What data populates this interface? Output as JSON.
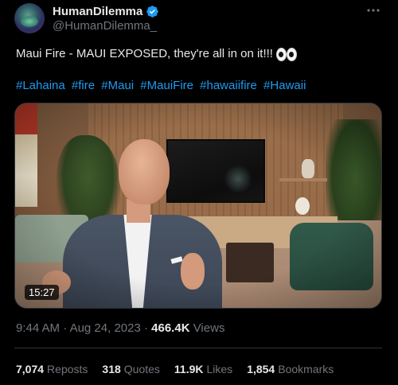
{
  "author": {
    "display_name": "HumanDilemma",
    "handle": "@HumanDilemma_",
    "verified": true
  },
  "tweet": {
    "text": "Maui Fire - MAUI EXPOSED, they're all in on it!!!",
    "emoji": "eyes",
    "hashtags": [
      "#Lahaina",
      "#fire",
      "#Maui",
      "#MauiFire",
      "#hawaiifire",
      "#Hawaii"
    ]
  },
  "media": {
    "duration": "15:27"
  },
  "meta": {
    "time": "9:44 AM",
    "separator": "·",
    "date": "Aug 24, 2023",
    "views_count": "466.4K",
    "views_label": "Views"
  },
  "stats": [
    {
      "count": "7,074",
      "label": "Reposts"
    },
    {
      "count": "318",
      "label": "Quotes"
    },
    {
      "count": "11.9K",
      "label": "Likes"
    },
    {
      "count": "1,854",
      "label": "Bookmarks"
    }
  ],
  "icons": {
    "more": "more-icon",
    "verified": "verified-badge-icon"
  },
  "colors": {
    "background": "#000000",
    "text": "#e7e9ea",
    "secondary": "#71767b",
    "link": "#1d9bf0",
    "verified": "#1d9bf0",
    "border": "#2f3336"
  }
}
